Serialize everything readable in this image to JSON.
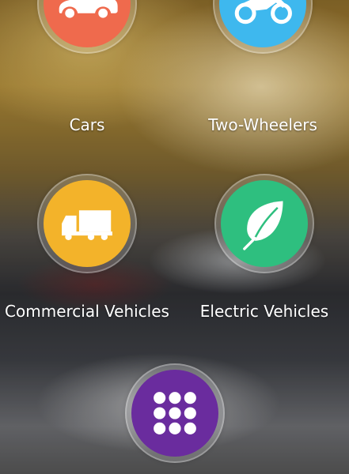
{
  "categories": [
    {
      "label": "Cars",
      "icon": "car-icon",
      "color": "#EF6A4D"
    },
    {
      "label": "Two-Wheelers",
      "icon": "motorcycle-icon",
      "color": "#3EB8EE"
    },
    {
      "label": "Commercial Vehicles",
      "icon": "truck-icon",
      "color": "#F3B32A"
    },
    {
      "label": "Electric Vehicles",
      "icon": "leaf-icon",
      "color": "#2EBF7F"
    }
  ],
  "more_button": {
    "icon": "grid-menu-icon",
    "color": "#6A2C9E"
  }
}
